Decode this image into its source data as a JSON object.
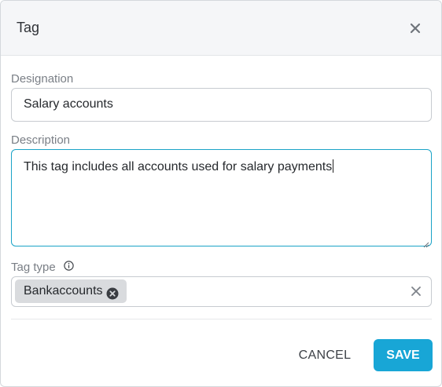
{
  "dialog": {
    "title": "Tag",
    "close_icon": "close-icon"
  },
  "form": {
    "designation": {
      "label": "Designation",
      "value": "Salary accounts"
    },
    "description": {
      "label": "Description",
      "value": "This tag includes all accounts used for salary payments"
    },
    "tag_type": {
      "label": "Tag type",
      "info_icon": "info-icon",
      "chips": [
        {
          "label": "Bankaccounts",
          "remove_icon": "remove-chip-icon"
        }
      ],
      "clear_icon": "clear-icon"
    }
  },
  "footer": {
    "cancel_label": "CANCEL",
    "save_label": "SAVE"
  },
  "colors": {
    "accent": "#18a6d6",
    "focus_border": "#1aa3c7",
    "header_bg": "#f5f6f8",
    "chip_bg": "#d9dbde"
  }
}
